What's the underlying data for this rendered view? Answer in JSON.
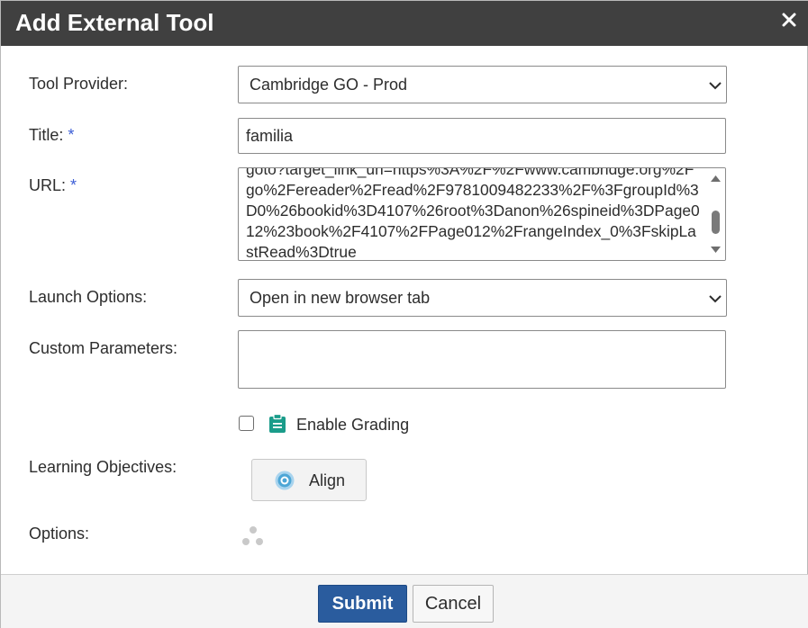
{
  "dialog": {
    "title": "Add External Tool",
    "close_icon": "close-icon"
  },
  "form": {
    "tool_provider": {
      "label": "Tool Provider:",
      "value": "Cambridge GO - Prod"
    },
    "title": {
      "label": "Title:",
      "required_marker": "*",
      "value": "familia"
    },
    "url": {
      "label": "URL:",
      "required_marker": "*",
      "value": "goto?target_link_uri=https%3A%2F%2Fwww.cambridge.org%2Fgo%2Fereader%2Fread%2F9781009482233%2F%3FgroupId%3D0%26bookid%3D4107%26root%3Danon%26spineid%3DPage012%23book%2F4107%2FPage012%2FrangeIndex_0%3FskipLastRead%3Dtrue"
    },
    "launch_options": {
      "label": "Launch Options:",
      "value": "Open in new browser tab"
    },
    "custom_parameters": {
      "label": "Custom Parameters:",
      "value": ""
    },
    "grading": {
      "label": "Enable Grading",
      "checked": false,
      "icon": "clipboard-icon"
    },
    "learning_objectives": {
      "label": "Learning Objectives:",
      "align_label": "Align",
      "icon": "target-icon"
    },
    "options": {
      "label": "Options:",
      "icon": "loading-dots-icon"
    }
  },
  "footer": {
    "submit_label": "Submit",
    "cancel_label": "Cancel"
  },
  "colors": {
    "titlebar": "#404040",
    "required": "#3d5fd6",
    "submit": "#2a5c9e",
    "clipboard_icon": "#1a9c8a",
    "align_icon": "#4da6d6"
  }
}
